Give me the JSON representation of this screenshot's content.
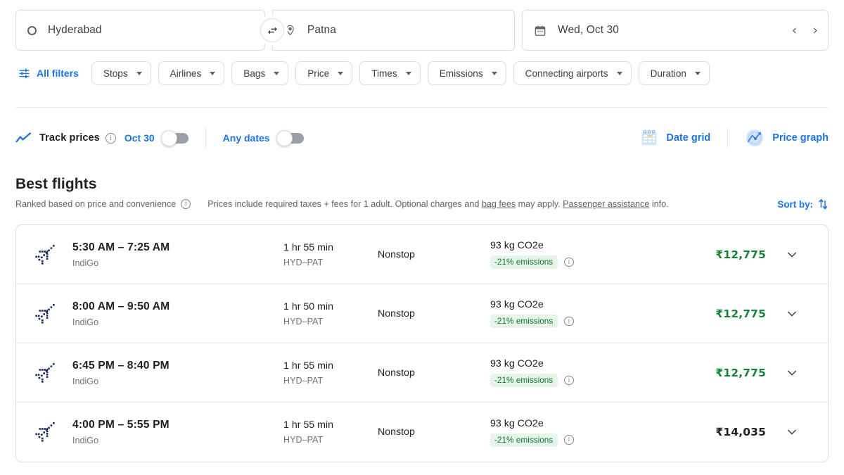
{
  "search": {
    "origin": "Hyderabad",
    "destination": "Patna",
    "date": "Wed, Oct 30",
    "origin_icon": "circle-outline-icon",
    "destination_icon": "location-pin-icon",
    "swap_icon": "swap-arrows-icon",
    "calendar_icon": "calendar-icon",
    "prev_date_label": "‹",
    "next_date_label": "›"
  },
  "filters": {
    "all_filters_label": "All filters",
    "all_filters_icon": "tune-sliders-icon",
    "chips": [
      {
        "label": "Stops"
      },
      {
        "label": "Airlines"
      },
      {
        "label": "Bags"
      },
      {
        "label": "Price"
      },
      {
        "label": "Times"
      },
      {
        "label": "Emissions"
      },
      {
        "label": "Connecting airports"
      },
      {
        "label": "Duration"
      }
    ]
  },
  "tracking": {
    "track_icon": "trending-line-icon",
    "track_label": "Track prices",
    "track_info_icon": "info-icon",
    "date_label": "Oct 30",
    "date_toggle_state": "off",
    "any_dates_label": "Any dates",
    "any_dates_toggle_state": "off",
    "date_grid_label": "Date grid",
    "date_grid_icon": "calendar-grid-icon",
    "price_graph_label": "Price graph",
    "price_graph_icon": "price-graph-icon"
  },
  "results": {
    "heading": "Best flights",
    "ranked_note": "Ranked based on price and convenience",
    "ranked_info_icon": "info-icon",
    "prices_note_pre": "Prices include required taxes + fees for 1 adult. Optional charges and ",
    "prices_note_link1": "bag fees",
    "prices_note_mid": " may apply. ",
    "prices_note_link2": "Passenger assistance",
    "prices_note_post": " info.",
    "sort_by_label": "Sort by:",
    "sort_icon": "sort-arrows-icon",
    "flights": [
      {
        "airline_logo": "indigo-logo-icon",
        "times": "5:30 AM – 7:25 AM",
        "airline": "IndiGo",
        "duration": "1 hr 55 min",
        "route": "HYD–PAT",
        "stops": "Nonstop",
        "emissions": "93 kg CO2e",
        "emissions_badge": "-21% emissions",
        "emissions_info_icon": "info-icon",
        "price": "₹12,775",
        "price_style": "green",
        "expand_icon": "chevron-down-icon"
      },
      {
        "airline_logo": "indigo-logo-icon",
        "times": "8:00 AM – 9:50 AM",
        "airline": "IndiGo",
        "duration": "1 hr 50 min",
        "route": "HYD–PAT",
        "stops": "Nonstop",
        "emissions": "93 kg CO2e",
        "emissions_badge": "-21% emissions",
        "emissions_info_icon": "info-icon",
        "price": "₹12,775",
        "price_style": "green",
        "expand_icon": "chevron-down-icon"
      },
      {
        "airline_logo": "indigo-logo-icon",
        "times": "6:45 PM – 8:40 PM",
        "airline": "IndiGo",
        "duration": "1 hr 55 min",
        "route": "HYD–PAT",
        "stops": "Nonstop",
        "emissions": "93 kg CO2e",
        "emissions_badge": "-21% emissions",
        "emissions_info_icon": "info-icon",
        "price": "₹12,775",
        "price_style": "green",
        "expand_icon": "chevron-down-icon"
      },
      {
        "airline_logo": "indigo-logo-icon",
        "times": "4:00 PM – 5:55 PM",
        "airline": "IndiGo",
        "duration": "1 hr 55 min",
        "route": "HYD–PAT",
        "stops": "Nonstop",
        "emissions": "93 kg CO2e",
        "emissions_badge": "-21% emissions",
        "emissions_info_icon": "info-icon",
        "price": "₹14,035",
        "price_style": "dark",
        "expand_icon": "chevron-down-icon"
      }
    ]
  },
  "colors": {
    "accent_blue": "#1a73e8",
    "price_green": "#188038",
    "badge_bg": "#e6f4ea",
    "border": "#dadce0",
    "indigo_navy": "#1c2b5e"
  }
}
